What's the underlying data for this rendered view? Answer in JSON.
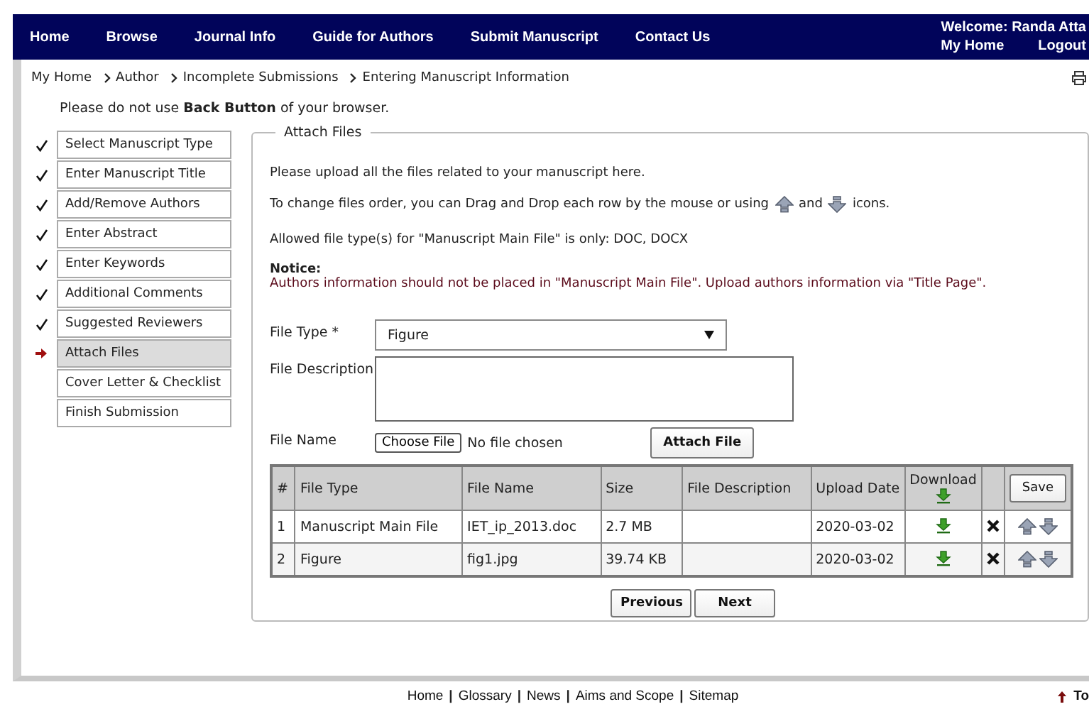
{
  "nav": {
    "items": [
      "Home",
      "Browse",
      "Journal Info",
      "Guide for Authors",
      "Submit Manuscript",
      "Contact Us"
    ],
    "welcome": "Welcome: Randa Atta",
    "links": [
      "My Home",
      "Logout"
    ]
  },
  "breadcrumb": [
    "My Home",
    "Author",
    "Incomplete Submissions",
    "Entering Manuscript Information"
  ],
  "warning": "Please do not use **Back Button** of your browser.",
  "steps": [
    {
      "label": "Select Manuscript Type",
      "done": true,
      "selected": false
    },
    {
      "label": "Enter Manuscript Title",
      "done": true,
      "selected": false
    },
    {
      "label": "Add/Remove Authors",
      "done": true,
      "selected": false
    },
    {
      "label": "Enter Abstract",
      "done": true,
      "selected": false
    },
    {
      "label": "Enter Keywords",
      "done": true,
      "selected": false
    },
    {
      "label": "Additional Comments",
      "done": true,
      "selected": false
    },
    {
      "label": "Suggested Reviewers",
      "done": true,
      "selected": false
    },
    {
      "label": "Attach Files",
      "done": false,
      "selected": true
    },
    {
      "label": "Cover Letter & Checklist",
      "done": false,
      "selected": false
    },
    {
      "label": "Finish Submission",
      "done": false,
      "selected": false
    }
  ],
  "attach": {
    "legend": "Attach Files",
    "intro": "Please upload all the files related to your manuscript here.",
    "order_before": "To change files order, you can Drag and Drop each row by the mouse or using",
    "order_and": "and",
    "order_after": "icons.",
    "allowed": "Allowed file type(s) for \"Manuscript Main File\" is only: DOC, DOCX",
    "notice_title": "Notice:",
    "notice": "Authors information should not be placed in \"Manuscript Main File\". Upload authors information via \"Title Page\".",
    "file_type_label": "File Type *",
    "file_type_value": "Figure",
    "description_label": "File Description",
    "file_name_label": "File Name",
    "choose_button": "Choose File",
    "no_file": "No file chosen",
    "attach_button": "Attach File"
  },
  "table": {
    "columns": [
      "#",
      "File Type",
      "File Name",
      "Size",
      "File Description",
      "Upload Date",
      "Download"
    ],
    "save_button": "Save",
    "rows": [
      {
        "num": "1",
        "file_type": "Manuscript Main File",
        "file_name": "IET_ip_2013.doc",
        "size": "2.7 MB",
        "upload_date": "2020-03-02"
      },
      {
        "num": "2",
        "file_type": "Figure",
        "file_name": "fig1.jpg",
        "size": "39.74 KB",
        "upload_date": "2020-03-02"
      }
    ]
  },
  "buttons": [
    "Previous",
    "Next"
  ],
  "footer": {
    "links": [
      "Home",
      "Glossary",
      "News",
      "Aims and Scope",
      "Sitemap"
    ],
    "separator": "|",
    "to_top": "To"
  }
}
